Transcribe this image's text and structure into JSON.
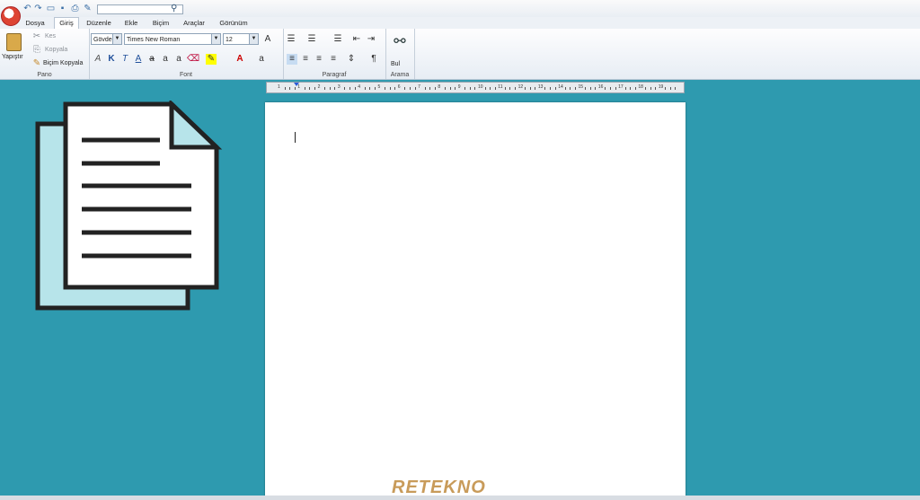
{
  "quick_access": {
    "icons": [
      "undo-icon",
      "redo-icon",
      "open-icon",
      "save-icon",
      "print-icon",
      "brush-icon"
    ],
    "search_value": ""
  },
  "tabs": [
    {
      "label": "Dosya"
    },
    {
      "label": "Giriş",
      "active": true
    },
    {
      "label": "Düzenle"
    },
    {
      "label": "Ekle"
    },
    {
      "label": "Biçim"
    },
    {
      "label": "Araçlar"
    },
    {
      "label": "Görünüm"
    }
  ],
  "ribbon": {
    "pano": {
      "label": "Pano",
      "paste": "Yapıştır",
      "cut": "Kes",
      "copy": "Kopyala",
      "format_painter": "Biçim Kopyala"
    },
    "font": {
      "label": "Font",
      "style": "Gövde",
      "family": "Times New Roman",
      "size": "12"
    },
    "paragraph": {
      "label": "Paragraf"
    },
    "search": {
      "label": "Arama",
      "find": "Bul"
    }
  },
  "ruler": {
    "marks": [
      "1",
      "1",
      "2",
      "3",
      "4",
      "5",
      "6",
      "7",
      "8",
      "9",
      "10",
      "11",
      "12",
      "13",
      "14",
      "15",
      "16",
      "17",
      "18",
      "19"
    ]
  },
  "watermark": {
    "text": "RETEKNO"
  },
  "colors": {
    "background": "#2e9aaf",
    "icon_fill": "#b7e4ea",
    "watermark": "#c89b5a"
  }
}
